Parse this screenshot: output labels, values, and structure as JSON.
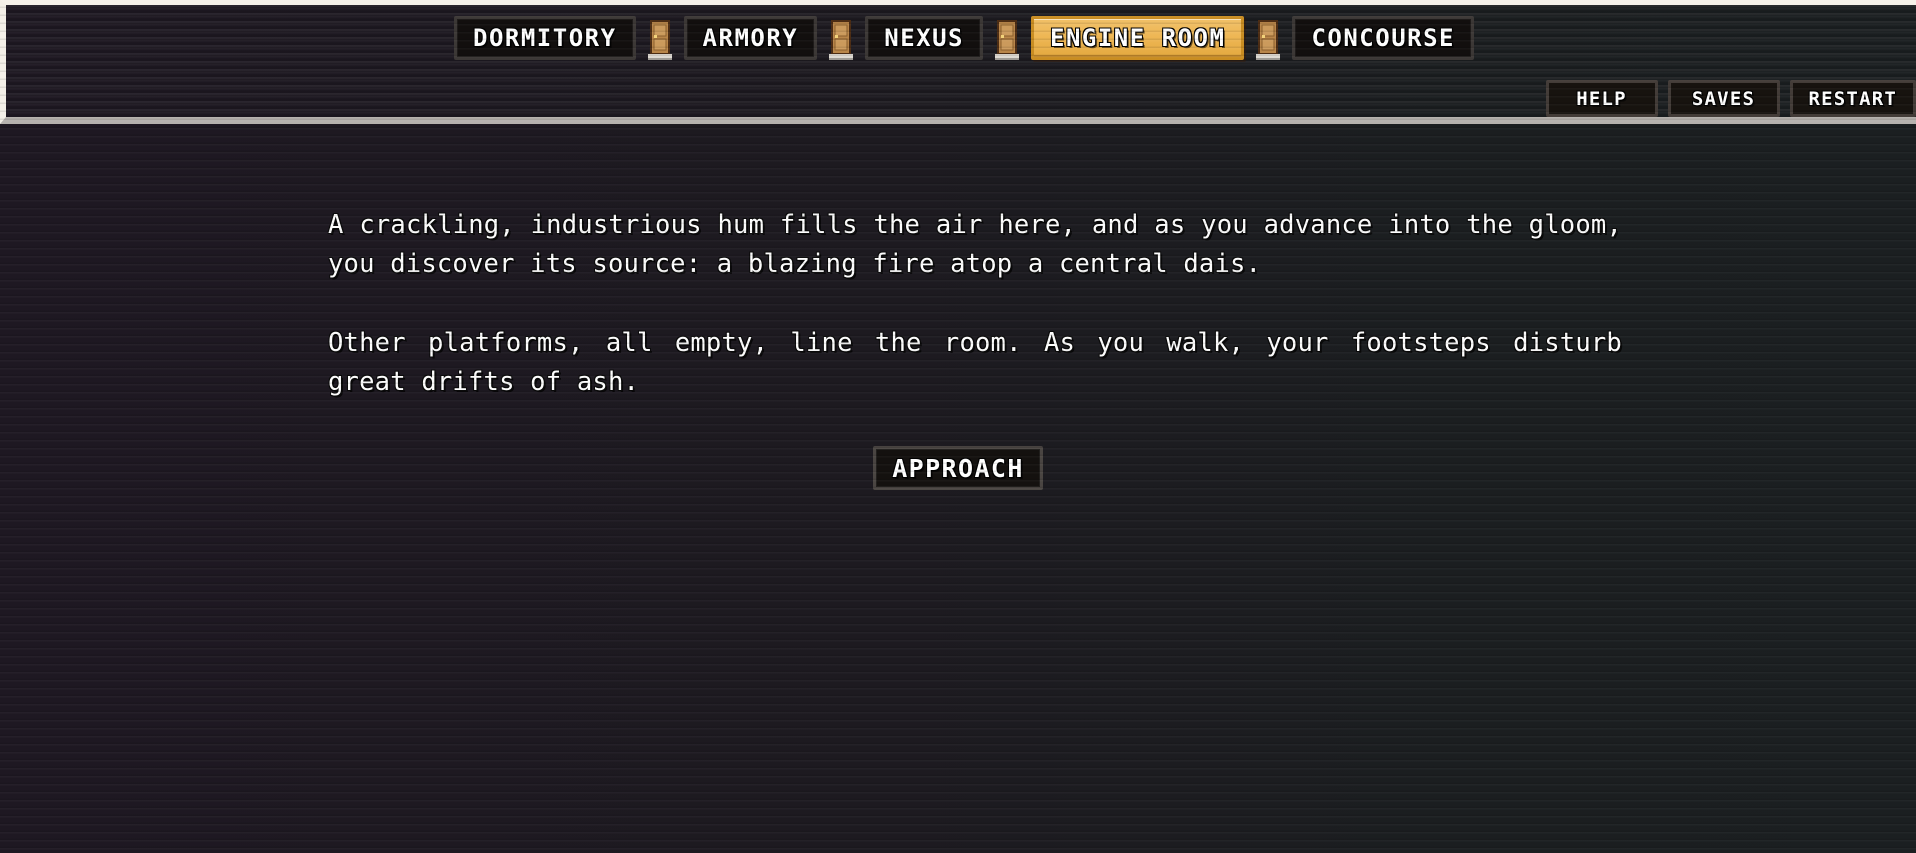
{
  "colors": {
    "header_gradient_start": "#c2561f",
    "header_gradient_end": "#9e5a5a",
    "header_border_light": "#f4f0e8",
    "header_border_bottom": "#b6b2ae",
    "active_tab_bg": "#eeb755",
    "active_tab_border": "#c98d22",
    "tab_bg": "#120f0e",
    "tab_border": "#3c3836",
    "body_bg_left": "#1e1822",
    "body_bg_right": "#1b1f21",
    "text": "#fdfdfd",
    "door_wood": "#c08c4a",
    "door_frame": "#5a3418",
    "door_knob": "#f0cc6a",
    "door_step": "#ded9d2"
  },
  "header": {
    "nav": {
      "tabs": [
        {
          "id": "dormitory",
          "label": "DORMITORY",
          "active": false
        },
        {
          "id": "armory",
          "label": "ARMORY",
          "active": false
        },
        {
          "id": "nexus",
          "label": "NEXUS",
          "active": false
        },
        {
          "id": "engine-room",
          "label": "ENGINE ROOM",
          "active": true
        },
        {
          "id": "concourse",
          "label": "CONCOURSE",
          "active": false
        }
      ],
      "separator_icon": "door-icon",
      "separator_count": 4
    },
    "utility_buttons": [
      {
        "id": "help",
        "label": "HELP"
      },
      {
        "id": "saves",
        "label": "SAVES"
      },
      {
        "id": "restart",
        "label": "RESTART"
      }
    ]
  },
  "main": {
    "paragraphs": [
      "A crackling, industrious hum fills the air here, and as you advance into the gloom, you discover its source: a blazing fire atop a central dais.",
      "Other platforms, all empty, line the room. As you walk, your footsteps disturb great drifts of ash."
    ],
    "actions": [
      {
        "id": "approach",
        "label": "APPROACH"
      }
    ]
  }
}
